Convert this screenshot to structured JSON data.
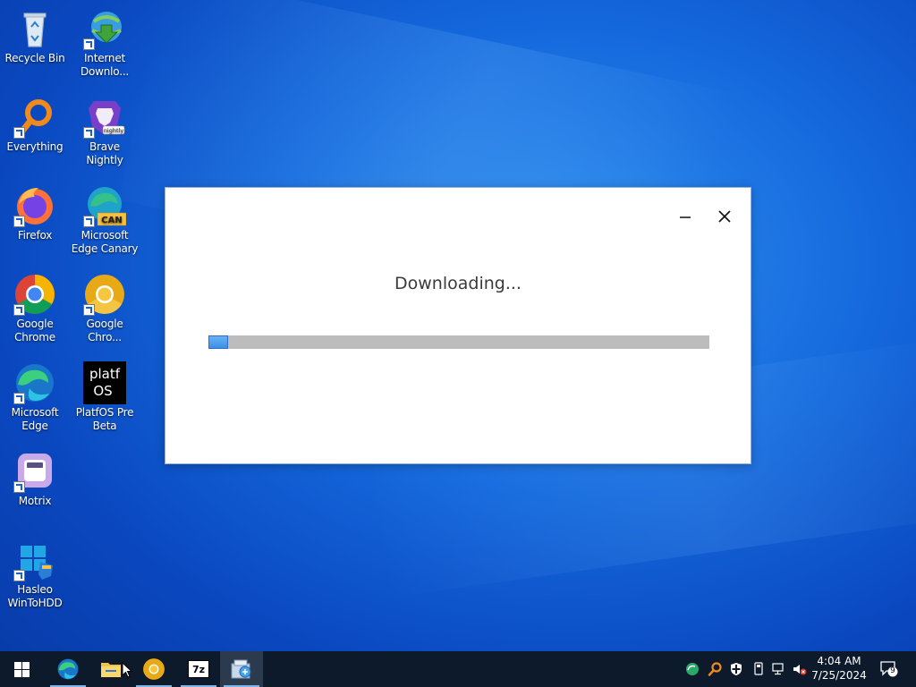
{
  "desktop": {
    "icons": [
      {
        "label": "Recycle Bin"
      },
      {
        "label": "Internet Downlo..."
      },
      {
        "label": "Everything"
      },
      {
        "label": "Brave Nightly",
        "badge": "nightly"
      },
      {
        "label": "Firefox"
      },
      {
        "label": "Microsoft Edge Canary",
        "badge": "CAN"
      },
      {
        "label": "Google Chrome"
      },
      {
        "label": "Google Chro..."
      },
      {
        "label": "Microsoft Edge"
      },
      {
        "label": "PlatfOS Pre Beta",
        "logo_line1": "platf",
        "logo_line2": "OS"
      },
      {
        "label": "Motrix"
      },
      {
        "label": "Hasleo WinToHDD"
      }
    ]
  },
  "dialog": {
    "status_text": "Downloading...",
    "progress_fraction": 0.04,
    "buttons": [
      {
        "icon": "minimize-icon"
      },
      {
        "icon": "close-icon"
      }
    ]
  },
  "taskbar": {
    "items": [
      {
        "icon": "windows-start-icon"
      },
      {
        "icon": "edge-icon"
      },
      {
        "icon": "file-explorer-icon"
      },
      {
        "icon": "chrome-canary-icon"
      },
      {
        "icon": "7zip-icon",
        "text": "7z"
      },
      {
        "icon": "installer-icon",
        "active": true
      }
    ],
    "tray": {
      "time": "4:04 AM",
      "date": "7/25/2024",
      "notification_count": "9"
    }
  },
  "colors": {
    "progress_fill": "#3b8ee8",
    "progress_track": "#bcbcbc",
    "taskbar_bg": "#0c1a2b"
  }
}
